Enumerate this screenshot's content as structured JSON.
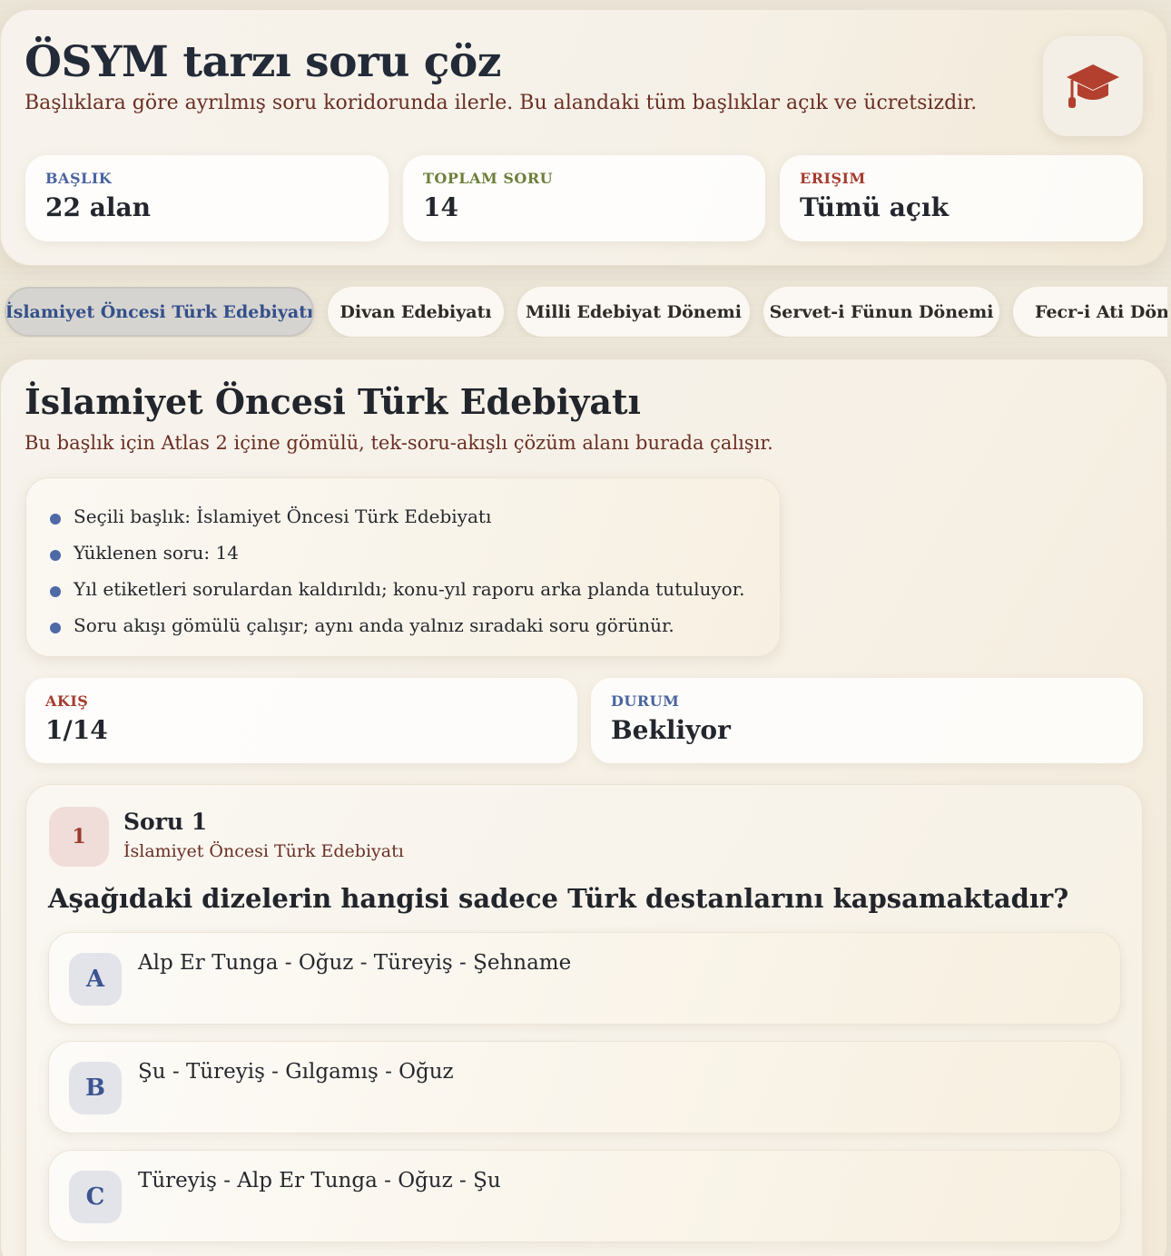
{
  "hero": {
    "title": "ÖSYM tarzı soru çöz",
    "subtitle": "Başlıklara göre ayrılmış soru koridorunda ilerle. Bu alandaki tüm başlıklar açık ve ücretsizdir.",
    "icon": "graduation-cap-icon",
    "stats": [
      {
        "label": "BAŞLIK",
        "value": "22 alan",
        "color": "#4a64a0"
      },
      {
        "label": "TOPLAM SORU",
        "value": "14",
        "color": "#6b7f3a"
      },
      {
        "label": "ERIŞIM",
        "value": "Tümü açık",
        "color": "#a63b2e"
      }
    ]
  },
  "tabs": [
    {
      "label": "İslamiyet Öncesi Türk Edebiyatı",
      "active": true
    },
    {
      "label": "Divan Edebiyatı",
      "active": false
    },
    {
      "label": "Milli Edebiyat Dönemi",
      "active": false
    },
    {
      "label": "Servet-i Fünun Dönemi",
      "active": false
    },
    {
      "label": "Fecr-i Ati Dönemi",
      "active": false
    }
  ],
  "section": {
    "title": "İslamiyet Öncesi Türk Edebiyatı",
    "description": "Bu başlık için Atlas 2 içine gömülü, tek-soru-akışlı çözüm alanı burada çalışır.",
    "info": [
      "Seçili başlık: İslamiyet Öncesi Türk Edebiyatı",
      "Yüklenen soru: 14",
      "Yıl etiketleri sorulardan kaldırıldı; konu-yıl raporu arka planda tutuluyor.",
      "Soru akışı gömülü çalışır; aynı anda yalnız sıradaki soru görünür."
    ],
    "flow": {
      "label": "AKIŞ",
      "value": "1/14",
      "color": "#a63b2e"
    },
    "status": {
      "label": "DURUM",
      "value": "Bekliyor",
      "color": "#4a64a0"
    }
  },
  "question": {
    "number": "1",
    "title": "Soru 1",
    "topic": "İslamiyet Öncesi Türk Edebiyatı",
    "text": "Aşağıdaki dizelerin hangisi sadece Türk destanlarını kapsamaktadır?",
    "options": [
      {
        "letter": "A",
        "text": "Alp Er Tunga - Oğuz - Türeyiş - Şehname"
      },
      {
        "letter": "B",
        "text": "Şu - Türeyiş - Gılgamış - Oğuz"
      },
      {
        "letter": "C",
        "text": "Türeyiş - Alp Er Tunga - Oğuz - Şu"
      }
    ]
  }
}
